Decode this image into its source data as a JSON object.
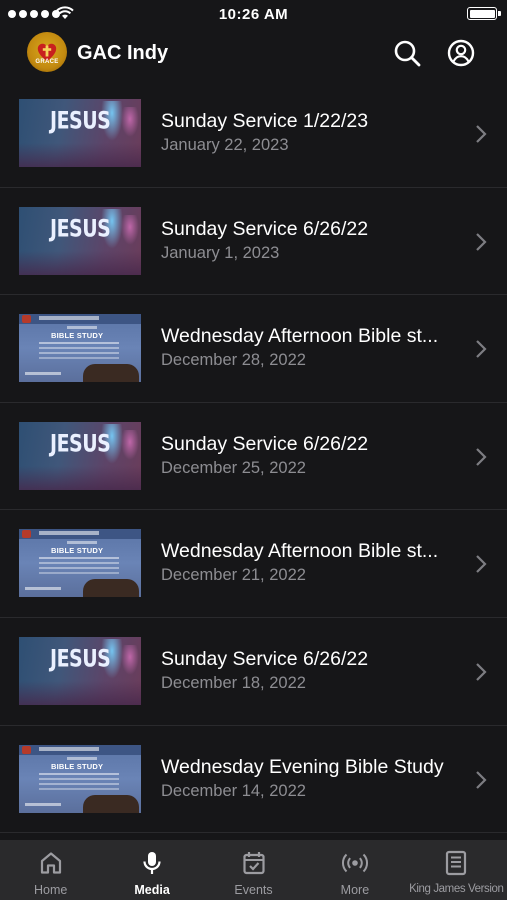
{
  "status_bar": {
    "time": "10:26 AM"
  },
  "header": {
    "app_title": "GAC Indy",
    "logo_text": "GRACE"
  },
  "thumbnails": {
    "jesus_word": "JESUS",
    "bible_title": "BIBLE STUDY"
  },
  "media_items": [
    {
      "title": "Sunday Service 1/22/23",
      "date": "January 22, 2023",
      "thumb": "jesus"
    },
    {
      "title": "Sunday Service 6/26/22",
      "date": "January 1, 2023",
      "thumb": "jesus"
    },
    {
      "title": "Wednesday Afternoon Bible st...",
      "date": "December 28, 2022",
      "thumb": "bible"
    },
    {
      "title": "Sunday Service 6/26/22",
      "date": "December 25, 2022",
      "thumb": "jesus"
    },
    {
      "title": "Wednesday Afternoon Bible st...",
      "date": "December 21, 2022",
      "thumb": "bible"
    },
    {
      "title": "Sunday Service 6/26/22",
      "date": "December 18, 2022",
      "thumb": "jesus"
    },
    {
      "title": "Wednesday Evening Bible Study",
      "date": "December 14, 2022",
      "thumb": "bible"
    }
  ],
  "tabs": [
    {
      "label": "Home",
      "icon": "home-icon",
      "active": false
    },
    {
      "label": "Media",
      "icon": "microphone-icon",
      "active": true
    },
    {
      "label": "Events",
      "icon": "calendar-icon",
      "active": false
    },
    {
      "label": "More",
      "icon": "broadcast-icon",
      "active": false
    },
    {
      "label": "King James Version",
      "icon": "book-icon",
      "active": false
    }
  ],
  "colors": {
    "background": "#161618",
    "tabbar": "#2a2a2c",
    "secondary_text": "#8d8d92",
    "active_tab": "#ffffff"
  }
}
